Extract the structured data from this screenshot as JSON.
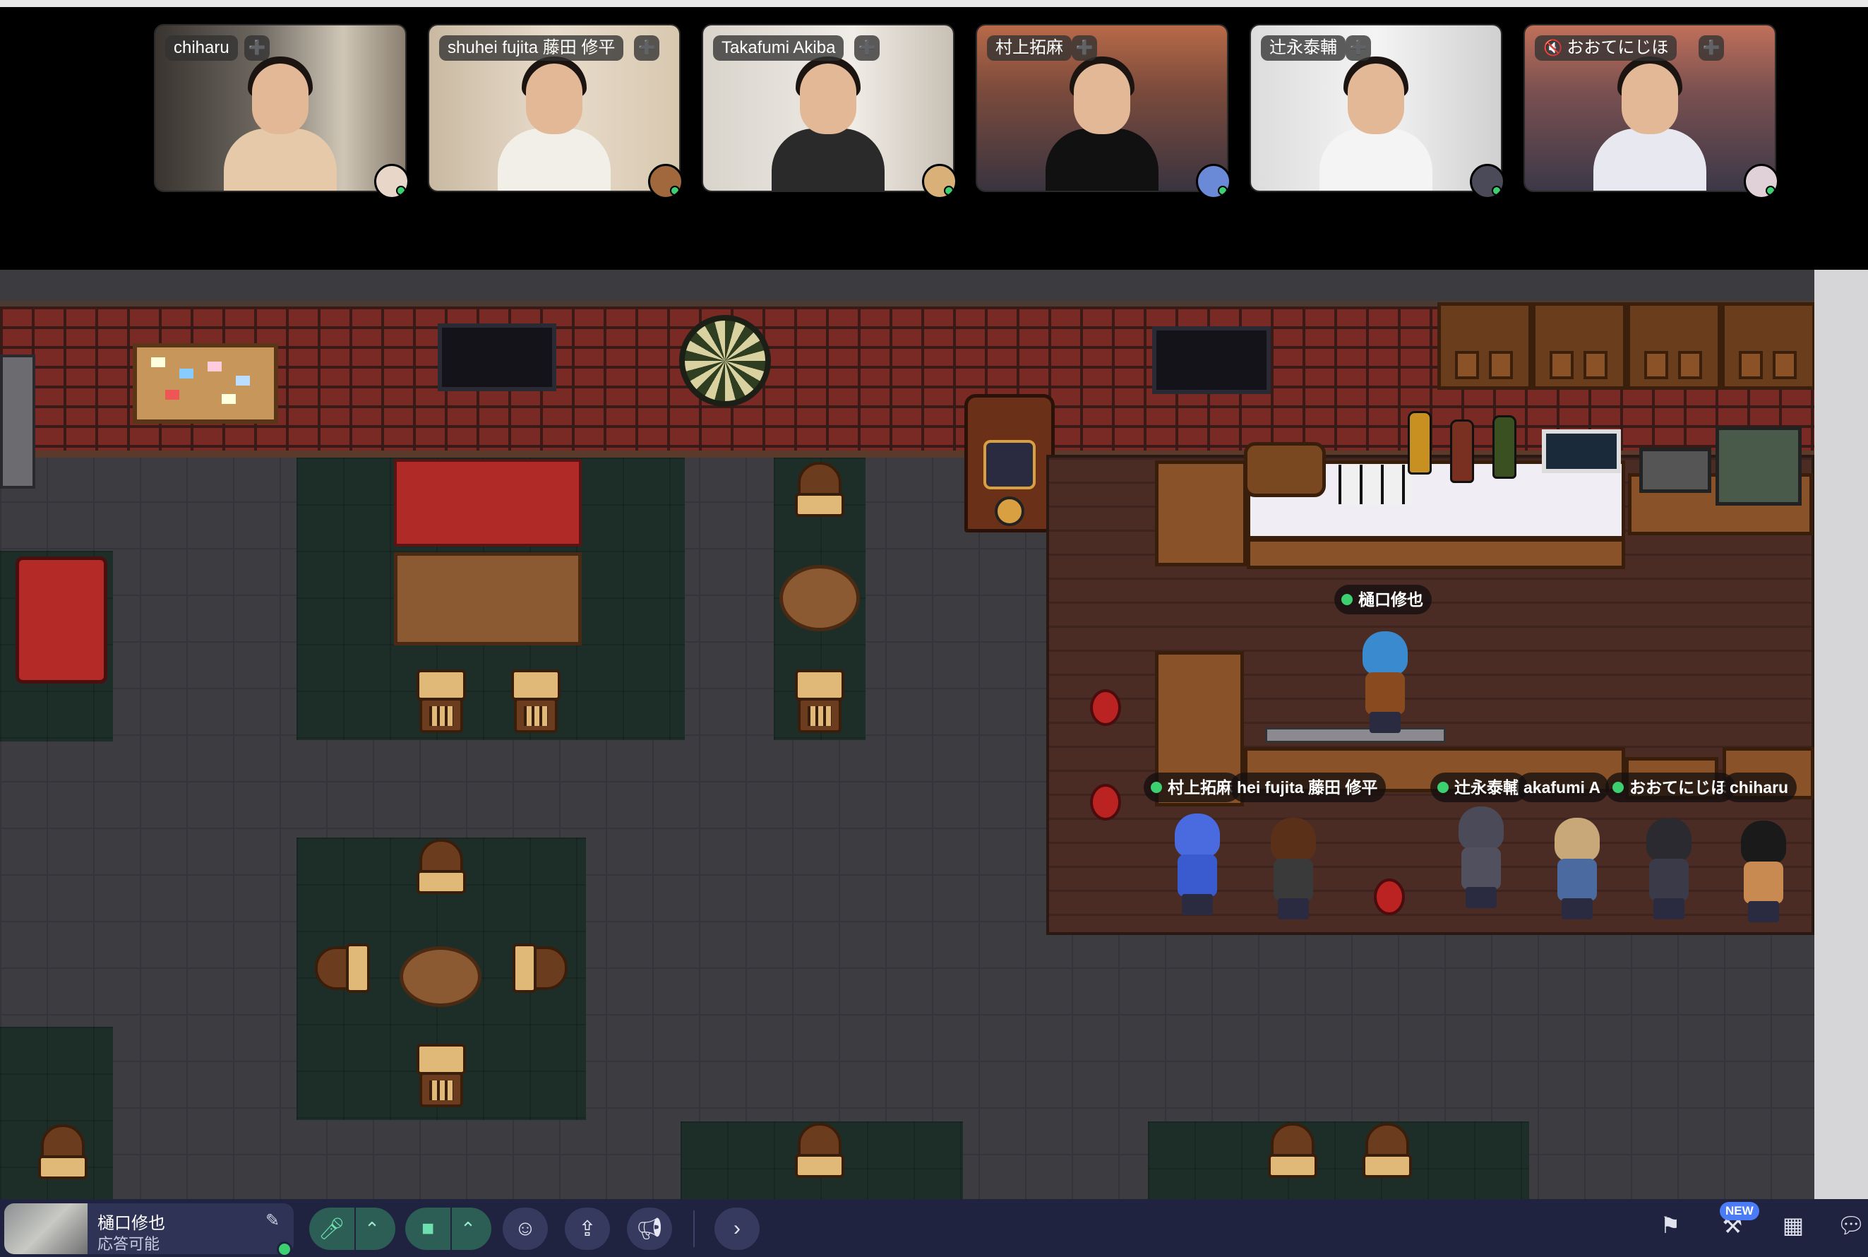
{
  "video_tiles": [
    {
      "name": "chiharu",
      "muted": false
    },
    {
      "name": "shuhei fujita 藤田 修平",
      "muted": false
    },
    {
      "name": "Takafumi Akiba",
      "muted": false
    },
    {
      "name": "村上拓麻",
      "muted": false
    },
    {
      "name": "辻永泰輔",
      "muted": false
    },
    {
      "name": "おおてにじほ",
      "muted": true
    }
  ],
  "map_labels": {
    "bartender": "樋口修也",
    "p1": "村上拓麻",
    "p2": "hei fujita 藤田 修平",
    "p3": "辻永泰輔",
    "p4": "akafumi A",
    "p5": "おおてにじほ",
    "p6": "chiharu"
  },
  "me": {
    "name": "樋口修也",
    "status": "応答可能"
  },
  "badges": {
    "new": "NEW"
  },
  "icons": {
    "add_friend": "person-add-icon",
    "mic": "microphone-icon",
    "camera": "video-camera-icon",
    "emoji": "emoji-icon",
    "share": "screen-share-icon",
    "megaphone": "megaphone-icon",
    "expand": "chevron-right-icon",
    "pencil": "pencil-icon"
  },
  "colors": {
    "status_online": "#3cd070",
    "bottom_bar": "#1f2340",
    "control_green": "#2c5e55",
    "new_badge": "#4b7bf7"
  }
}
